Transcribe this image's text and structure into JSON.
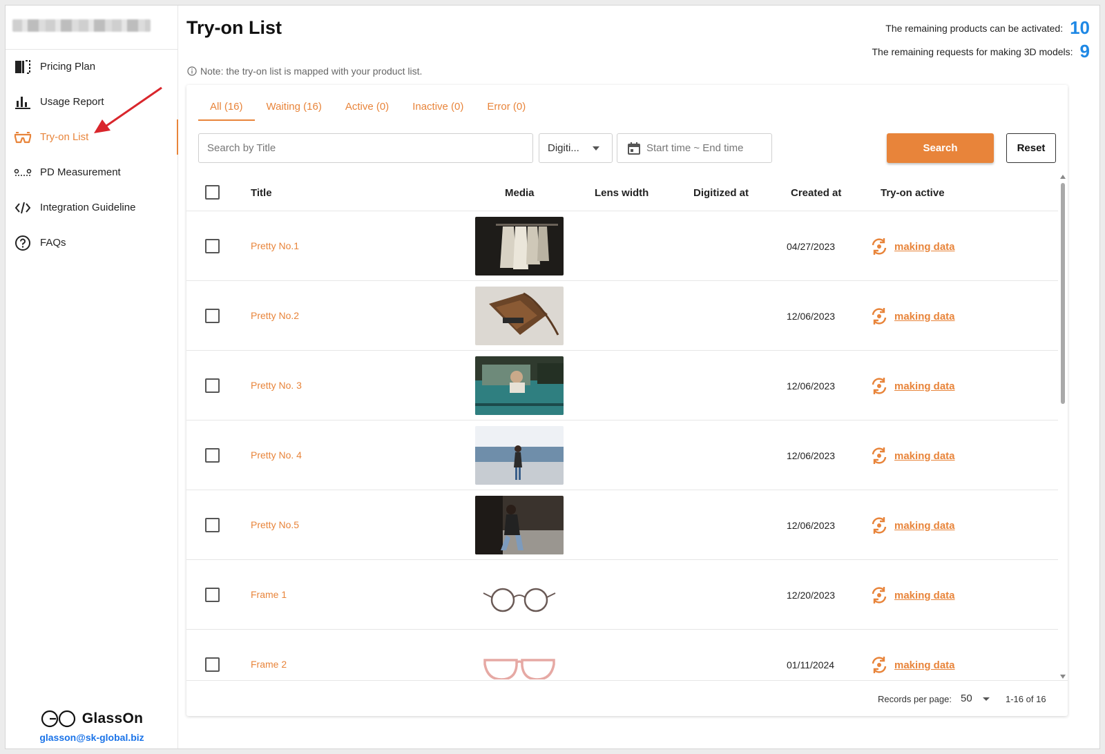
{
  "sidebar": {
    "items": [
      {
        "label": "Pricing Plan",
        "icon": "pricing-plan-icon"
      },
      {
        "label": "Usage Report",
        "icon": "bar-chart-icon"
      },
      {
        "label": "Try-on List",
        "icon": "glasses-icon",
        "active": true
      },
      {
        "label": "PD Measurement",
        "icon": "pd-measure-icon"
      },
      {
        "label": "Integration Guideline",
        "icon": "code-icon"
      },
      {
        "label": "FAQs",
        "icon": "question-icon"
      }
    ],
    "brand_name": "GlassOn",
    "brand_email": "glasson@sk-global.biz"
  },
  "header": {
    "title": "Try-on List",
    "note": "Note: the try-on list is mapped with your product list.",
    "remaining_products_label": "The remaining products can be activated:",
    "remaining_products_value": "10",
    "remaining_requests_label": "The remaining requests for making 3D models:",
    "remaining_requests_value": "9"
  },
  "tabs": [
    {
      "label": "All (16)",
      "selected": true
    },
    {
      "label": "Waiting (16)"
    },
    {
      "label": "Active (0)"
    },
    {
      "label": "Inactive (0)"
    },
    {
      "label": "Error (0)"
    }
  ],
  "filters": {
    "search_placeholder": "Search by Title",
    "select_value": "Digiti...",
    "date_placeholder": "Start time ~ End time",
    "search_button": "Search",
    "reset_button": "Reset"
  },
  "table": {
    "columns": {
      "title": "Title",
      "media": "Media",
      "lens_width": "Lens width",
      "digitized_at": "Digitized at",
      "created_at": "Created at",
      "tryon_active": "Try-on active"
    },
    "rows": [
      {
        "title": "Pretty No.1",
        "created": "04/27/2023",
        "status": "making data",
        "media": "clothes-rack-photo"
      },
      {
        "title": "Pretty No.2",
        "created": "12/06/2023",
        "status": "making data",
        "media": "leather-bag-photo"
      },
      {
        "title": "Pretty No. 3",
        "created": "12/06/2023",
        "status": "making data",
        "media": "woman-in-truck-photo"
      },
      {
        "title": "Pretty No. 4",
        "created": "12/06/2023",
        "status": "making data",
        "media": "woman-standing-photo"
      },
      {
        "title": "Pretty No.5",
        "created": "12/06/2023",
        "status": "making data",
        "media": "woman-sitting-photo"
      },
      {
        "title": "Frame 1",
        "created": "12/20/2023",
        "status": "making data",
        "media": "round-glasses-photo"
      },
      {
        "title": "Frame 2",
        "created": "01/11/2024",
        "status": "making data",
        "media": "pink-glasses-photo"
      }
    ]
  },
  "footer": {
    "records_per_page_label": "Records per page:",
    "records_per_page_value": "50",
    "range": "1-16 of 16"
  },
  "colors": {
    "accent": "#e8843a",
    "counter": "#1e88e5",
    "link": "#1a73e8"
  }
}
